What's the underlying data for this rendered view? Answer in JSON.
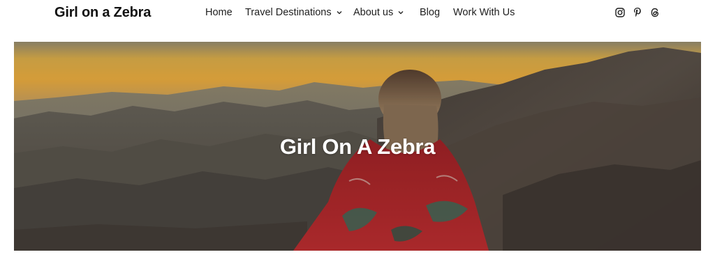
{
  "header": {
    "site_title": "Girl on a Zebra",
    "nav": {
      "home": "Home",
      "travel": "Travel Destinations",
      "about": "About us",
      "blog": "Blog",
      "work": "Work With Us"
    },
    "social_icons": [
      "instagram-icon",
      "pinterest-icon",
      "threads-icon"
    ]
  },
  "hero": {
    "title": "Girl On A Zebra"
  },
  "colors": {
    "text": "#1e1e1e",
    "sky_top": "#f0b54a",
    "blanket_red": "#b8282c"
  }
}
